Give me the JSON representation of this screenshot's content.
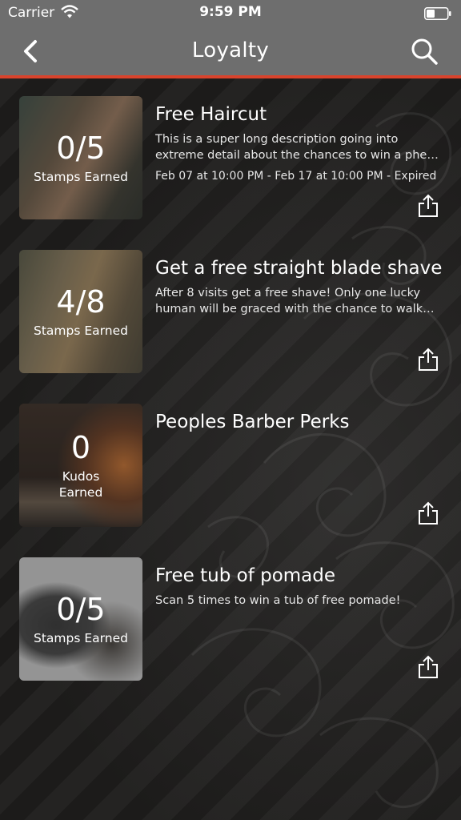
{
  "status_bar": {
    "carrier": "Carrier",
    "time": "9:59 PM"
  },
  "nav": {
    "title": "Loyalty",
    "back_icon": "chevron-left-icon",
    "search_icon": "search-icon"
  },
  "colors": {
    "nav_bg": "#6e6e6e",
    "accent": "#d9432c",
    "background": "#1f1e1d"
  },
  "rewards": [
    {
      "count": "0/5",
      "unit": "Stamps Earned",
      "title": "Free Haircut",
      "description": "This is a super long description going into extreme detail about the chances to win a phe…",
      "dates": "Feb 07 at 10:00 PM - Feb 17 at 10:00 PM - Expired",
      "progress": 0
    },
    {
      "count": "4/8",
      "unit": "Stamps Earned",
      "title": "Get a free straight blade shave",
      "description": "After 8 visits get a free shave! Only one lucky human will be graced with the chance to walk a…",
      "dates": "",
      "progress": 0.5
    },
    {
      "count": "0",
      "unit": "Kudos Earned",
      "title": "Peoples Barber Perks",
      "description": "",
      "dates": "",
      "progress": 0
    },
    {
      "count": "0/5",
      "unit": "Stamps Earned",
      "title": "Free tub of pomade",
      "description": "Scan 5 times to win a tub of free pomade!",
      "dates": "",
      "progress": 0
    }
  ]
}
